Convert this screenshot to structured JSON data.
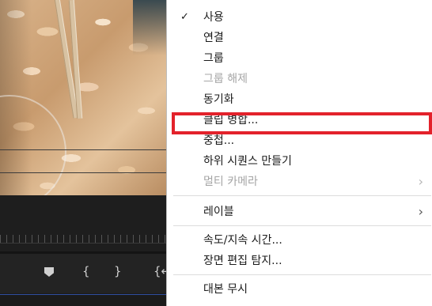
{
  "context_menu": {
    "items": [
      {
        "label": "사용",
        "checked": true,
        "disabled": false
      },
      {
        "label": "연결",
        "disabled": false
      },
      {
        "label": "그룹",
        "disabled": false
      },
      {
        "label": "그룹 해제",
        "disabled": true
      },
      {
        "label": "동기화",
        "disabled": false
      },
      {
        "label": "클립 병합...",
        "disabled": false,
        "highlighted": true
      },
      {
        "label": "중첩...",
        "disabled": false
      },
      {
        "label": "하위 시퀀스 만들기",
        "disabled": false
      },
      {
        "label": "멀티 카메라",
        "disabled": true,
        "submenu": true
      },
      {
        "label": "레이블",
        "disabled": false,
        "submenu": true
      },
      {
        "label": "속도/지속 시간...",
        "disabled": false
      },
      {
        "label": "장면 편집 탐지...",
        "disabled": false
      },
      {
        "label": "대본 무시",
        "disabled": false
      }
    ],
    "check_glyph": "✓",
    "submenu_glyph": "›",
    "highlight_color": "#e3222b"
  },
  "timeline": {
    "icons": [
      "marker-icon",
      "mark-in-icon",
      "mark-out-icon",
      "go-to-in-icon"
    ],
    "glyphs": {
      "mark_in": "{",
      "mark_out": "}",
      "go_to_in": "{←"
    }
  }
}
